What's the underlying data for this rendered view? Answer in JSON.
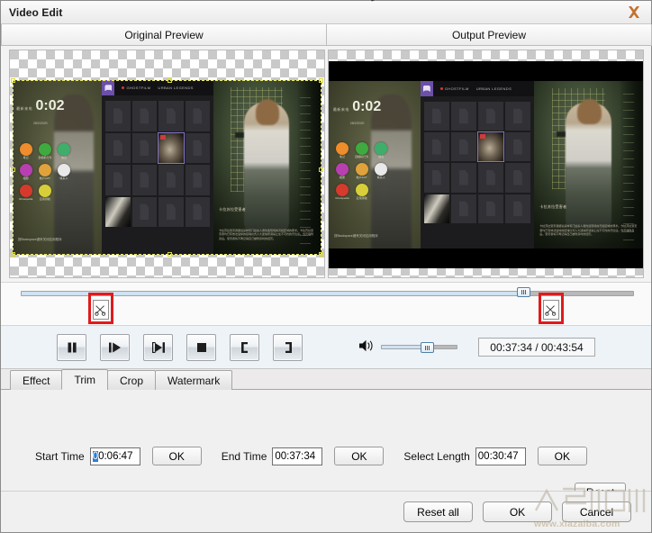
{
  "window": {
    "title": "Video Edit",
    "close_icon": "close-x-icon"
  },
  "preview_tabs": [
    {
      "label": "Original Preview"
    },
    {
      "label": "Output Preview"
    }
  ],
  "preview_content": {
    "phone": {
      "time_small": "最新来电",
      "time_big": "0:02",
      "date": "28/2/2020",
      "footer": "按Backspace键来关闭应用程序",
      "apps": [
        {
          "label": "笔记",
          "color": "#ef8c2b"
        },
        {
          "label": "自相机行为",
          "color": "#3faa3f"
        },
        {
          "label": "信息",
          "color": "#3fae6a"
        },
        {
          "label": "相册",
          "color": "#b83fb0"
        },
        {
          "label": "帐户ACT",
          "color": "#e0a23a"
        },
        {
          "label": "联系人",
          "color": "#e9e9e9"
        },
        {
          "label": "Ghostpedia",
          "color": "#d63a2c"
        },
        {
          "label": "应用测验",
          "color": "#d6cf3a"
        }
      ]
    },
    "gallery": {
      "badge_icon": "ghost-badge-icon",
      "tab_recording": "GHOSTFILM",
      "tab_legends": "URBAN LEGENDS"
    },
    "caption": {
      "title": "卡拉苏拉受害者",
      "body": "卡拉苏拉受害者据说某种专门给杀人者伪造现场的灵媒区域的邪术。卡拉苏拉受害者均已有效法追悼的招魂仪式人大迷信所谓禁止在不可约的灵位迎。当灵魂附身后。受害者将不再记得自己被附身时的经历。"
    }
  },
  "timeline": {
    "play_position_percent": 82,
    "start_marker_percent": 13,
    "end_marker_percent": 85,
    "scissor_icon": "scissors-icon"
  },
  "transport": {
    "buttons": [
      {
        "name": "pause-button",
        "icon": "pause-icon"
      },
      {
        "name": "play-step-button",
        "icon": "play-step-icon"
      },
      {
        "name": "next-frame-button",
        "icon": "next-frame-icon"
      },
      {
        "name": "stop-button",
        "icon": "stop-icon"
      },
      {
        "name": "mark-in-button",
        "icon": "bracket-left-icon"
      },
      {
        "name": "mark-out-button",
        "icon": "bracket-right-icon"
      }
    ],
    "volume_icon": "speaker-icon",
    "volume_percent": 60,
    "timecode": "00:37:34 / 00:43:54"
  },
  "tabs": [
    {
      "label": "Effect",
      "active": false
    },
    {
      "label": "Trim",
      "active": true
    },
    {
      "label": "Crop",
      "active": false
    },
    {
      "label": "Watermark",
      "active": false
    }
  ],
  "trim": {
    "start_time": {
      "label": "Start Time",
      "value": "00:06:47",
      "selected_prefix": "0",
      "rest": "0:06:47",
      "ok": "OK"
    },
    "end_time": {
      "label": "End Time",
      "value": "00:37:34",
      "ok": "OK"
    },
    "select_length": {
      "label": "Select Length",
      "value": "00:30:47",
      "ok": "OK"
    },
    "reset": "Reset"
  },
  "footer": {
    "reset_all": "Reset all",
    "ok": "OK",
    "cancel": "Cancel"
  },
  "watermark": {
    "text": "www.xiazaiba.com"
  },
  "colors": {
    "accent_blue": "#2a7fd4",
    "marker_red": "#e01b1b",
    "close_orange": "#c4702c",
    "selection_yellow": "#e8e85c"
  }
}
